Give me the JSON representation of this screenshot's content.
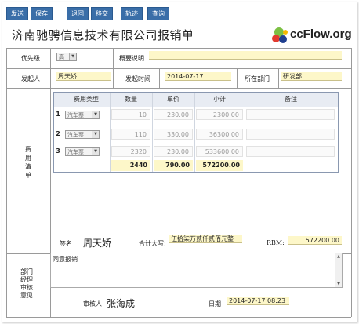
{
  "toolbar": {
    "buttons": [
      "发送",
      "保存",
      "退回",
      "移交",
      "轨迹",
      "查询"
    ]
  },
  "header": {
    "title": "济南驰骋信息技术有限公司报销单",
    "logo_text": "ccFlow.org"
  },
  "form": {
    "priority_label": "优先级",
    "priority_value": "高",
    "summary_label": "概要说明",
    "summary_value": "",
    "initiator_label": "发起人",
    "initiator_value": "周天娇",
    "start_time_label": "发起时间",
    "start_time_value": "2014-07-17",
    "dept_label": "所在部门",
    "dept_value": "研发部",
    "expense_section_label": "费用清单",
    "table": {
      "headers": [
        "费用类型",
        "数量",
        "单价",
        "小计",
        "备注"
      ],
      "rows": [
        {
          "num": "1",
          "type": "汽车票",
          "qty": "10",
          "price": "230.00",
          "subtotal": "2300.00",
          "note": ""
        },
        {
          "num": "2",
          "type": "汽车票",
          "qty": "110",
          "price": "330.00",
          "subtotal": "36300.00",
          "note": ""
        },
        {
          "num": "3",
          "type": "汽车票",
          "qty": "2320",
          "price": "230.00",
          "subtotal": "533600.00",
          "note": ""
        }
      ],
      "totals": {
        "qty": "2440",
        "price": "790.00",
        "subtotal": "572200.00"
      }
    },
    "sign_label": "签名",
    "sign_value": "周天娇",
    "upper_label": "合计大写:",
    "upper_value": "伍拾柒万贰仟贰佰元整",
    "rmb_label": "RBM:",
    "rmb_value": "572200.00",
    "review_label": "部门经理审核意见",
    "review_text": "同意报销",
    "reviewer_label": "审核人",
    "reviewer_value": "张海成",
    "date_label": "日期",
    "date_value": "2014-07-17 08:23"
  },
  "colors": {
    "button_bg": "#3a6ea8",
    "field_bg": "#fdf7c9",
    "grid_header": "#e8ecf3"
  }
}
